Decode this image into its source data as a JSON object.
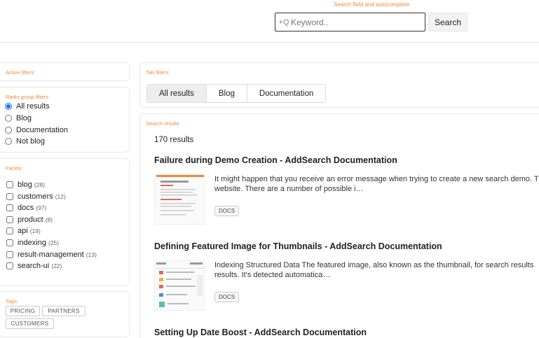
{
  "search": {
    "caption": "Search field and autocomplete",
    "icon_text": "+Q",
    "placeholder": "Keyword..",
    "button_label": "Search"
  },
  "filters": {
    "active_caption": "Active filters:",
    "radio_caption": "Radio group filters:",
    "radio_options": [
      {
        "label": "All results",
        "checked": true
      },
      {
        "label": "Blog",
        "checked": false
      },
      {
        "label": "Documentation",
        "checked": false
      },
      {
        "label": "Not blog",
        "checked": false
      }
    ],
    "facets_caption": "Facets:",
    "facets": [
      {
        "label": "blog",
        "count": "(28)"
      },
      {
        "label": "customers",
        "count": "(12)"
      },
      {
        "label": "docs",
        "count": "(97)"
      },
      {
        "label": "product",
        "count": "(8)"
      },
      {
        "label": "api",
        "count": "(19)"
      },
      {
        "label": "indexing",
        "count": "(25)"
      },
      {
        "label": "result-management",
        "count": "(13)"
      },
      {
        "label": "search-ui",
        "count": "(22)"
      }
    ],
    "tags_caption": "Tags:",
    "tags": [
      "PRICING",
      "PARTNERS",
      "CUSTOMERS"
    ]
  },
  "tabs": {
    "caption": "Tab filters:",
    "items": [
      {
        "label": "All results",
        "active": true
      },
      {
        "label": "Blog",
        "active": false
      },
      {
        "label": "Documentation",
        "active": false
      }
    ]
  },
  "results": {
    "caption": "Search results",
    "count_text": "170 results",
    "items": [
      {
        "title": "Failure during Demo Creation - AddSearch Documentation",
        "snippet": "It might happen that you receive an error message when trying to create a new search demo. T website. There are a number of possible i…",
        "badge": "DOCS"
      },
      {
        "title": "Defining Featured Image for Thumbnails - AddSearch Documentation",
        "snippet": "Indexing Structured Data The featured image, also known as the thumbnail, for search results results. It's detected automatica…",
        "badge": "DOCS"
      },
      {
        "title": "Setting Up Date Boost - AddSearch Documentation"
      }
    ]
  },
  "colors": {
    "caption_accent": "#f08a3c",
    "active_tab_bg": "#eeeeee"
  }
}
